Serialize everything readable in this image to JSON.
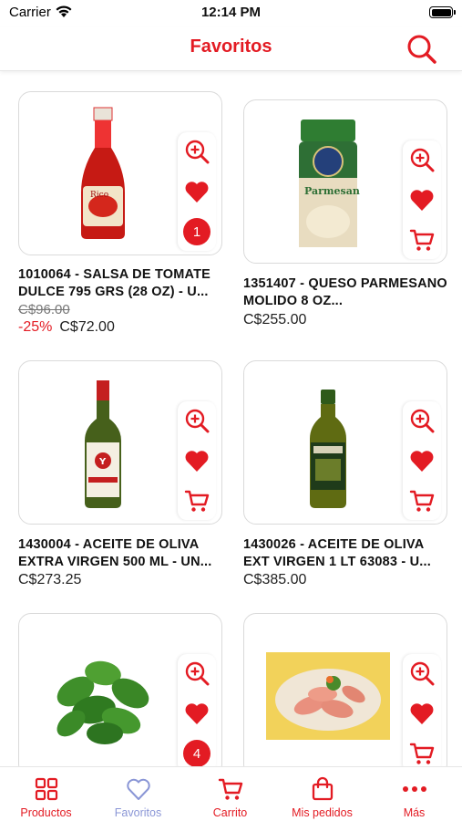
{
  "status_bar": {
    "carrier": "Carrier",
    "time": "12:14 PM"
  },
  "header": {
    "title": "Favoritos",
    "search_icon": "search-icon"
  },
  "colors": {
    "accent": "#e31b23",
    "active_tab": "#8a96d6"
  },
  "products": [
    {
      "name": "1010064 - SALSA DE TOMATE DULCE 795 GRS (28 OZ) - U...",
      "old_price": "C$96.00",
      "discount": "-25%",
      "price": "C$72.00",
      "cart_qty": "1"
    },
    {
      "name": "1351407 - QUESO PARMESANO MOLIDO 8 OZ...",
      "old_price": "",
      "discount": "",
      "price": "C$255.00",
      "cart_qty": ""
    },
    {
      "name": "1430004 - ACEITE DE OLIVA EXTRA VIRGEN 500 ML - UN...",
      "old_price": "",
      "discount": "",
      "price": "C$273.25",
      "cart_qty": ""
    },
    {
      "name": "1430026 - ACEITE DE OLIVA EXT VIRGEN 1 LT 63083 - U...",
      "old_price": "",
      "discount": "",
      "price": "C$385.00",
      "cart_qty": ""
    },
    {
      "name": "",
      "old_price": "",
      "discount": "",
      "price": "",
      "cart_qty": "4"
    },
    {
      "name": "",
      "old_price": "",
      "discount": "",
      "price": "",
      "cart_qty": ""
    }
  ],
  "tabs": [
    {
      "label": "Productos",
      "icon": "grid-icon"
    },
    {
      "label": "Favoritos",
      "icon": "heart-outline-icon"
    },
    {
      "label": "Carrito",
      "icon": "cart-icon"
    },
    {
      "label": "Mis pedidos",
      "icon": "bag-icon"
    },
    {
      "label": "Más",
      "icon": "more-icon"
    }
  ]
}
